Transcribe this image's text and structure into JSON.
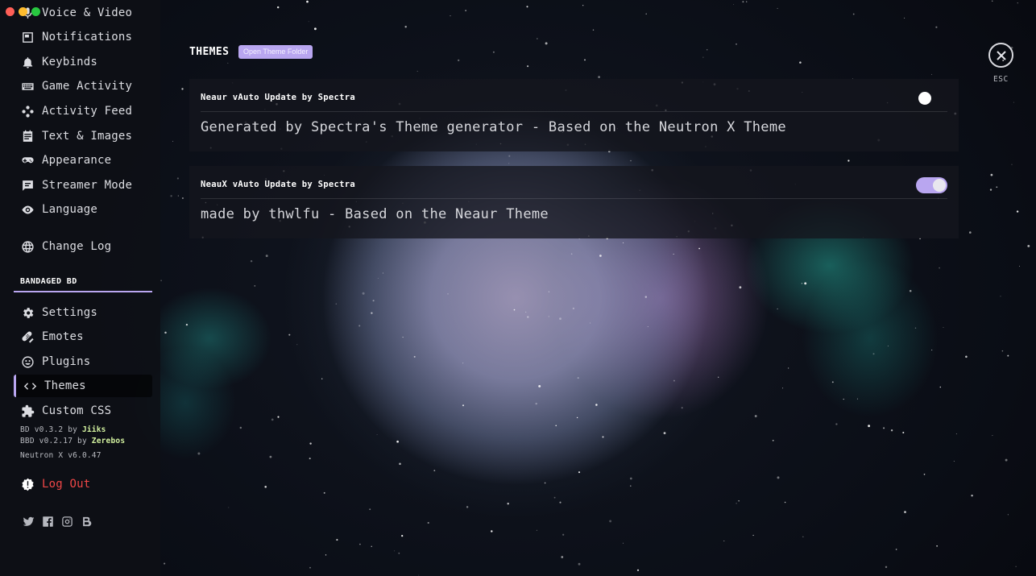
{
  "window": {
    "controls": [
      "close",
      "minimize",
      "maximize"
    ]
  },
  "sidebar": {
    "items": [
      {
        "label": "Voice & Video",
        "icon": "microphone-icon"
      },
      {
        "label": "Notifications",
        "icon": "notification-icon"
      },
      {
        "label": "Keybinds",
        "icon": "bell-icon"
      },
      {
        "label": "Game Activity",
        "icon": "keyboard-icon"
      },
      {
        "label": "Activity Feed",
        "icon": "gamepad-dpad-icon"
      },
      {
        "label": "Text & Images",
        "icon": "document-icon"
      },
      {
        "label": "Appearance",
        "icon": "controller-icon"
      },
      {
        "label": "Streamer Mode",
        "icon": "chat-icon"
      },
      {
        "label": "Language",
        "icon": "eye-icon"
      },
      {
        "label": "Change Log",
        "icon": "globe-icon"
      }
    ],
    "section_header": "BANDAGED BD",
    "bd_items": [
      {
        "label": "Settings",
        "icon": "cog-icon"
      },
      {
        "label": "Emotes",
        "icon": "bandage-icon"
      },
      {
        "label": "Plugins",
        "icon": "smiley-icon"
      },
      {
        "label": "Themes",
        "icon": "code-icon",
        "active": true
      },
      {
        "label": "Custom CSS",
        "icon": "puzzle-icon"
      }
    ],
    "versions": {
      "bd_prefix": "BD v0.3.2 by ",
      "bd_author": "Jiiks",
      "bbd_prefix": "BBD v0.2.17 by ",
      "bbd_author": "Zerebos",
      "neutron": "Neutron X v6.0.47"
    },
    "logout_label": "Log Out",
    "socials": [
      "twitter-icon",
      "facebook-icon",
      "instagram-icon",
      "discord-bd-icon"
    ]
  },
  "content": {
    "title": "THEMES",
    "open_folder_label": "Open Theme Folder",
    "themes": [
      {
        "name": "Neaur vAuto Update by Spectra",
        "description": "Generated by Spectra's Theme generator - Based on the Neutron X Theme",
        "enabled": false
      },
      {
        "name": "NeauX vAuto Update by Spectra",
        "description": "made by thwlfu - Based on the Neaur Theme",
        "enabled": true
      }
    ]
  },
  "close": {
    "label": "ESC"
  },
  "colors": {
    "accent": "#b9a6f0",
    "danger": "#f04747",
    "author_highlight": "#d3f2a0"
  }
}
